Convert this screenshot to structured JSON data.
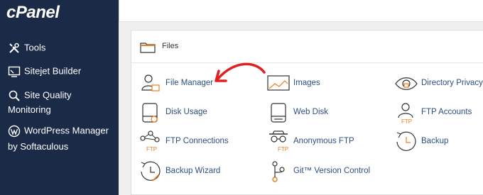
{
  "sidebar": {
    "logo": "cPanel",
    "items": [
      {
        "label": "Tools",
        "icon": "tools-icon"
      },
      {
        "label": "Sitejet Builder",
        "icon": "sitejet-icon"
      },
      {
        "label": "Site Quality",
        "sub": "Monitoring",
        "icon": "site-quality-icon"
      },
      {
        "label": "WordPress Manager",
        "sub": "by Softaculous",
        "icon": "wordpress-icon"
      }
    ]
  },
  "files": {
    "title": "Files",
    "items": [
      {
        "label": "File Manager",
        "icon": "file-manager-icon"
      },
      {
        "label": "Images",
        "icon": "images-icon"
      },
      {
        "label": "Directory Privacy",
        "icon": "directory-privacy-icon"
      },
      {
        "label": "Disk Usage",
        "icon": "disk-usage-icon"
      },
      {
        "label": "Web Disk",
        "icon": "web-disk-icon"
      },
      {
        "label": "FTP Accounts",
        "icon": "ftp-accounts-icon"
      },
      {
        "label": "FTP Connections",
        "icon": "ftp-connections-icon"
      },
      {
        "label": "Anonymous FTP",
        "icon": "anonymous-ftp-icon"
      },
      {
        "label": "Backup",
        "icon": "backup-icon"
      },
      {
        "label": "Backup Wizard",
        "icon": "backup-wizard-icon"
      },
      {
        "label": "Git™ Version Control",
        "icon": "git-icon"
      }
    ]
  },
  "annotation": {
    "color": "#e02020",
    "icon": "red-arrow-icon"
  },
  "colors": {
    "sidebar": "#1b2a47",
    "link": "#2c4f82",
    "accent": "#f07d1a"
  }
}
